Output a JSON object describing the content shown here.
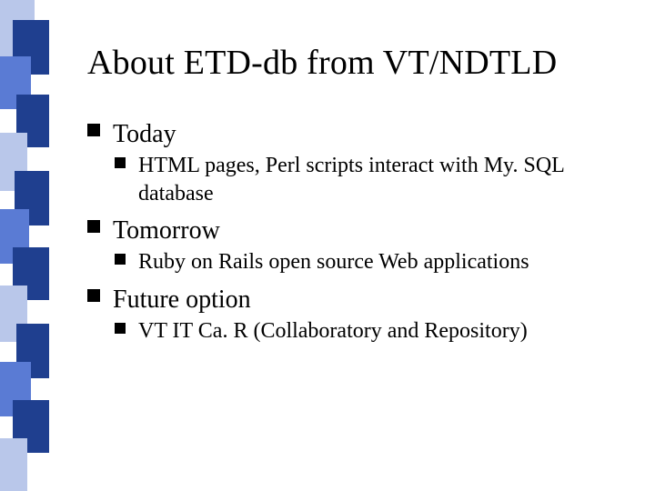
{
  "title": "About ETD-db from VT/NDTLD",
  "bullets": [
    {
      "label": "Today",
      "children": [
        "HTML pages, Perl scripts interact with My. SQL database"
      ]
    },
    {
      "label": "Tomorrow",
      "children": [
        "Ruby on Rails open source Web applications"
      ]
    },
    {
      "label": "Future option",
      "children": [
        "VT IT Ca. R (Collaboratory and Repository)"
      ]
    }
  ],
  "deco": {
    "baseColor": "#1f3f8f",
    "lightColor": "#5a7bd4",
    "edgeColor": "#b9c7ea"
  }
}
